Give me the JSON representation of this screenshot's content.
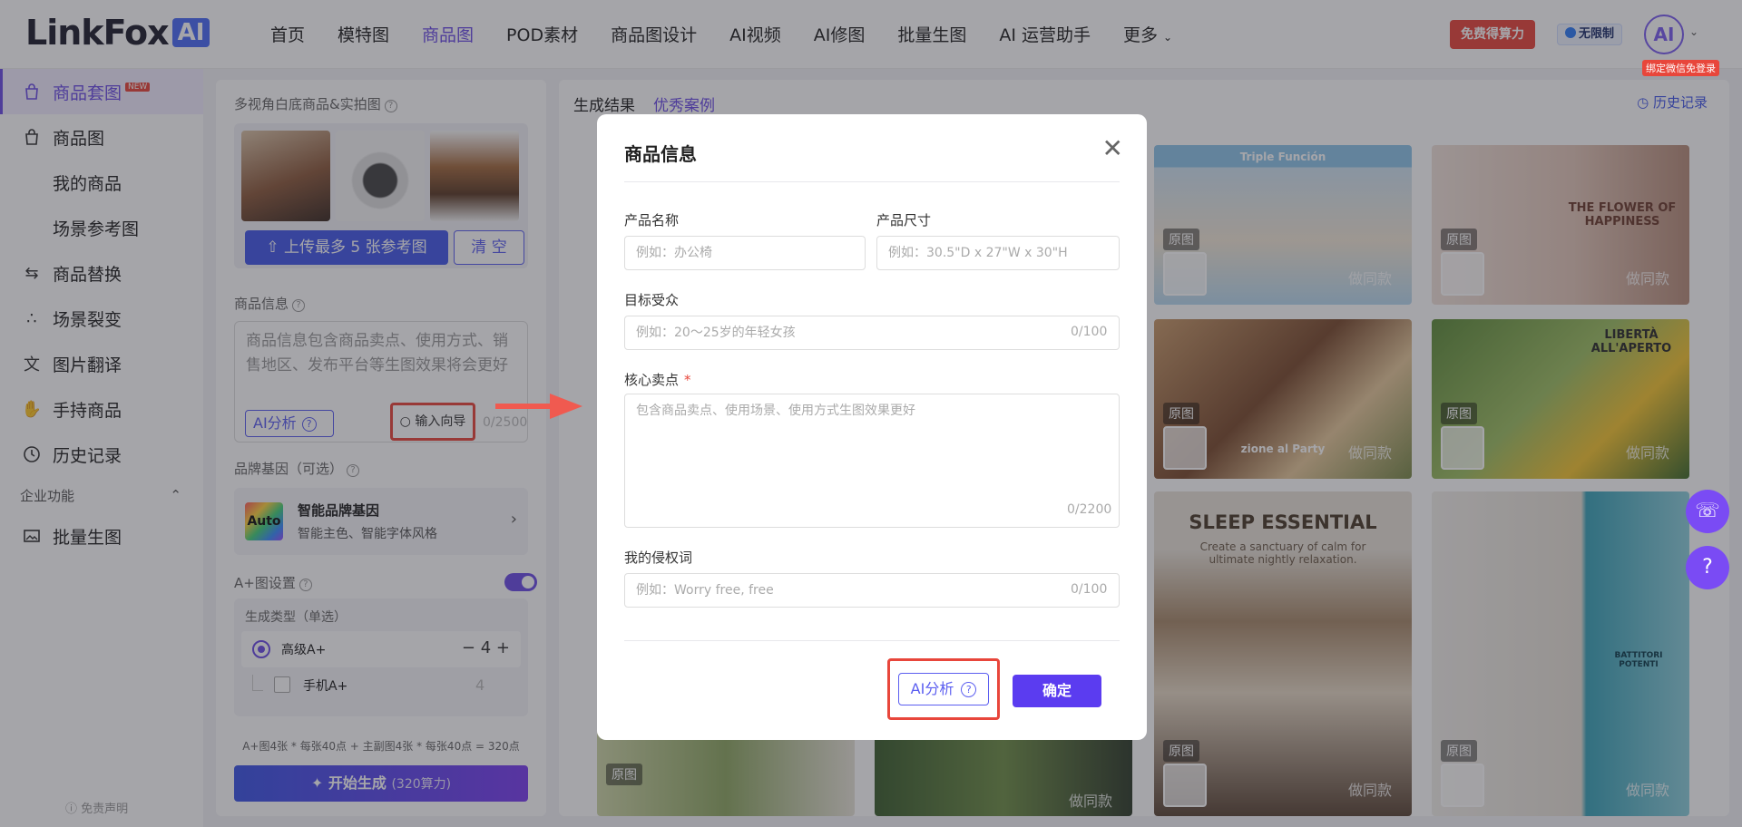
{
  "header": {
    "logo_text": "LinkFox",
    "logo_ai": "AI",
    "nav": [
      {
        "label": "首页",
        "active": false
      },
      {
        "label": "模特图",
        "active": false
      },
      {
        "label": "商品图",
        "active": true
      },
      {
        "label": "POD素材",
        "active": false
      },
      {
        "label": "商品图设计",
        "active": false
      },
      {
        "label": "AI视频",
        "active": false
      },
      {
        "label": "AI修图",
        "active": false
      },
      {
        "label": "批量生图",
        "active": false
      },
      {
        "label": "AI 运营助手",
        "active": false
      },
      {
        "label": "更多",
        "active": false
      }
    ],
    "free_power": "免费得算力",
    "unlimited": "无限制",
    "avatar": "AI",
    "wechat_tag": "绑定微信免登录"
  },
  "sidebar": {
    "items": [
      {
        "label": "商品套图",
        "icon": "bag-icon",
        "new": "NEW"
      },
      {
        "label": "商品图",
        "icon": "bag-icon"
      },
      {
        "label": "我的商品"
      },
      {
        "label": "场景参考图"
      },
      {
        "label": "商品替换",
        "icon": "swap-icon"
      },
      {
        "label": "场景裂变",
        "icon": "share-icon"
      },
      {
        "label": "图片翻译",
        "icon": "translate-icon"
      },
      {
        "label": "手持商品",
        "icon": "hand-icon"
      },
      {
        "label": "历史记录",
        "icon": "clock-icon"
      }
    ],
    "section_enterprise": "企业功能",
    "batch": "批量生图",
    "footer": "免责声明"
  },
  "panel": {
    "ref_label": "多视角白底商品&实拍图",
    "upload_btn": "上传最多 5 张参考图",
    "clear_btn": "清 空",
    "info_label": "商品信息",
    "info_placeholder": "商品信息包含商品卖点、使用方式、销售地区、发布平台等生图效果将会更好",
    "ai_btn": "AI分析",
    "guide_btn": "输入向导",
    "char_count": "0/2500",
    "brand_label": "品牌基因（可选）",
    "brand_auto": "Auto",
    "brand_title": "智能品牌基因",
    "brand_sub": "智能主色、智能字体风格",
    "aplus_label": "A+图设置",
    "gen_type_label": "生成类型（单选）",
    "opt_advanced": "高级A+",
    "opt_advanced_count": "4",
    "opt_mobile": "手机A+",
    "opt_mobile_count": "4",
    "formula": "A+图4张 * 每张40点 + 主副图4张 * 每张40点 = 320点",
    "start_btn": "开始生成",
    "start_cost": "(320算力)"
  },
  "results": {
    "tab_result": "生成结果",
    "tab_cases": "优秀案例",
    "history": "历史记录",
    "original_tag": "原图",
    "same_style": "做同款",
    "card_titles": [
      "Triple Función",
      "THE FLOWER OF HAPPINESS",
      "zione al Party",
      "LIBERTÀ ALL'APERTO",
      "SLEEP ESSENTIAL",
      "BATTITORI POTENTI"
    ],
    "card_subtitle_sleep": "Create a sanctuary of calm for ultimate nightly relaxation."
  },
  "modal": {
    "title": "商品信息",
    "name_label": "产品名称",
    "name_placeholder": "例如：办公椅",
    "size_label": "产品尺寸",
    "size_placeholder": "例如：30.5\"D x 27\"W x 30\"H",
    "audience_label": "目标受众",
    "audience_placeholder": "例如：20～25岁的年轻女孩",
    "audience_count": "0/100",
    "selling_label": "核心卖点",
    "selling_required": "*",
    "selling_placeholder": "包含商品卖点、使用场景、使用方式生图效果更好",
    "selling_count": "0/2200",
    "infringe_label": "我的侵权词",
    "infringe_placeholder": "例如：Worry free, free",
    "infringe_count": "0/100",
    "ai_btn": "AI分析",
    "ok_btn": "确定"
  }
}
